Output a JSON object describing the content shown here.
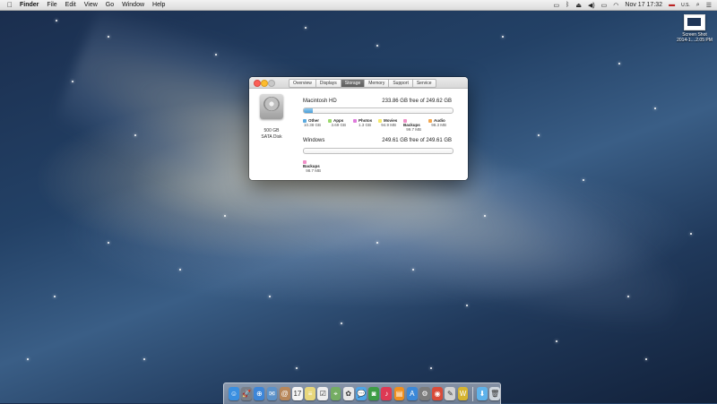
{
  "menubar": {
    "apple_icon": "apple-icon",
    "items": [
      "Finder",
      "File",
      "Edit",
      "View",
      "Go",
      "Window",
      "Help"
    ],
    "right": {
      "date_time": "Nov 17  17:32",
      "input_source": "U.S."
    },
    "status_icons": [
      "screen-icon",
      "bluetooth-icon",
      "eject-icon",
      "volume-icon",
      "battery-icon",
      "wifi-icon",
      "flag-icon",
      "search-icon",
      "list-icon"
    ]
  },
  "desktop": {
    "file": {
      "name_line1": "Screen Shot",
      "name_line2": "2014-1....2.05 PM"
    }
  },
  "window": {
    "tabs": [
      "Overview",
      "Displays",
      "Storage",
      "Memory",
      "Support",
      "Service"
    ],
    "active_tab": "Storage",
    "disk": {
      "size": "500 GB",
      "type": "SATA Disk"
    },
    "volumes": [
      {
        "name": "Macintosh HD",
        "free": "233.86 GB free of 249.62 GB",
        "categories": [
          {
            "name": "Other",
            "size": "10.38 GB",
            "color": "#5aa9de"
          },
          {
            "name": "Apps",
            "size": "3.69 GB",
            "color": "#9ad96b"
          },
          {
            "name": "Photos",
            "size": "1.3 GB",
            "color": "#e07bdc"
          },
          {
            "name": "Movies",
            "size": "94.9 MB",
            "color": "#f4e96b"
          },
          {
            "name": "Backups",
            "size": "99.7 MB",
            "color": "#f08fc8"
          },
          {
            "name": "Audio",
            "size": "98.3 MB",
            "color": "#f2a64e"
          }
        ],
        "used_fraction": 0.063
      },
      {
        "name": "Windows",
        "free": "249.61 GB free of 249.61 GB",
        "categories": [
          {
            "name": "Backups",
            "size": "98.7 MB",
            "color": "#f08fc8"
          }
        ],
        "used_fraction": 0.0
      }
    ]
  },
  "dock": {
    "apps": [
      {
        "name": "finder-icon",
        "glyph": "☺",
        "color": "#3a8fe0"
      },
      {
        "name": "launchpad-icon",
        "glyph": "🚀",
        "color": "#7a7f88"
      },
      {
        "name": "safari-icon",
        "glyph": "⊕",
        "color": "#3e86d8"
      },
      {
        "name": "mail-icon",
        "glyph": "✉",
        "color": "#5c91c8"
      },
      {
        "name": "contacts-icon",
        "glyph": "@",
        "color": "#b8875a"
      },
      {
        "name": "calendar-icon",
        "glyph": "17",
        "color": "#f4f4f4"
      },
      {
        "name": "notes-icon",
        "glyph": "≡",
        "color": "#e8d77c"
      },
      {
        "name": "reminders-icon",
        "glyph": "☑",
        "color": "#eeeeee"
      },
      {
        "name": "maps-icon",
        "glyph": "⌖",
        "color": "#75ad63"
      },
      {
        "name": "photos-icon",
        "glyph": "✿",
        "color": "#e9e9e9"
      },
      {
        "name": "messages-icon",
        "glyph": "💬",
        "color": "#4ea4e6"
      },
      {
        "name": "facetime-icon",
        "glyph": "◙",
        "color": "#3d9c45"
      },
      {
        "name": "itunes-icon",
        "glyph": "♪",
        "color": "#dd3a54"
      },
      {
        "name": "ibooks-icon",
        "glyph": "▤",
        "color": "#ef8f1f"
      },
      {
        "name": "app-store-icon",
        "glyph": "A",
        "color": "#3b88d8"
      },
      {
        "name": "system-preferences-icon",
        "glyph": "⚙",
        "color": "#7c7c7c"
      },
      {
        "name": "chrome-icon",
        "glyph": "◉",
        "color": "#d94b3a"
      },
      {
        "name": "script-editor-icon",
        "glyph": "✎",
        "color": "#d2d2d2"
      },
      {
        "name": "wine-icon",
        "glyph": "W",
        "color": "#d6b430"
      }
    ],
    "right": [
      {
        "name": "downloads-folder-icon",
        "glyph": "⬇",
        "color": "#5fb2ea"
      },
      {
        "name": "trash-icon",
        "glyph": "🗑",
        "color": "#cfd6dd"
      }
    ]
  }
}
